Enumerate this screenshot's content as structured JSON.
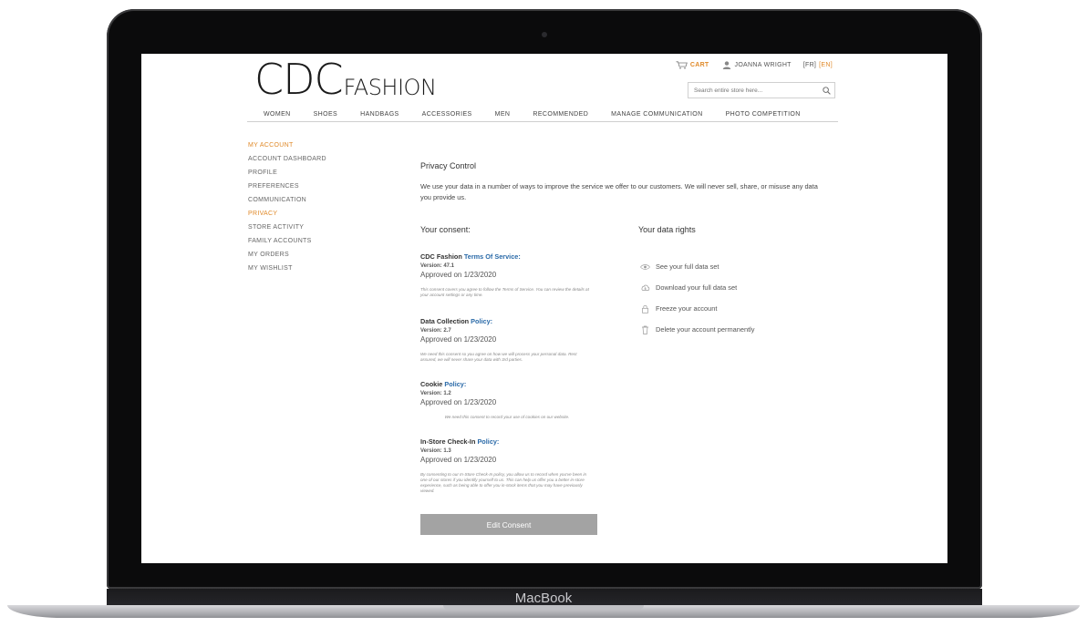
{
  "device": {
    "brand_label": "MacBook"
  },
  "header": {
    "logo": {
      "main": "CDC",
      "sub": "FASHION"
    },
    "cart_label": "CART",
    "user_name": "JOANNA WRIGHT",
    "languages": [
      {
        "label": "[FR]"
      },
      {
        "label": "[EN]",
        "active": true
      }
    ],
    "search_placeholder": "Search entire store here...",
    "accent_color": "#e08a2a"
  },
  "nav": {
    "items": [
      "WOMEN",
      "SHOES",
      "HANDBAGS",
      "ACCESSORIES",
      "MEN",
      "RECOMMENDED",
      "MANAGE COMMUNICATION",
      "PHOTO COMPETITION"
    ]
  },
  "sidebar": {
    "items": [
      {
        "label": "MY ACCOUNT",
        "active": true
      },
      {
        "label": "ACCOUNT DASHBOARD"
      },
      {
        "label": "PROFILE"
      },
      {
        "label": "PREFERENCES"
      },
      {
        "label": "COMMUNICATION"
      },
      {
        "label": "PRIVACY",
        "active": true
      },
      {
        "label": "STORE ACTIVITY"
      },
      {
        "label": "FAMILY ACCOUNTS"
      },
      {
        "label": "MY ORDERS"
      },
      {
        "label": "MY WISHLIST"
      }
    ]
  },
  "main": {
    "title": "Privacy Control",
    "intro": "We use your data in a number of ways to improve the service we offer to our customers. We will never sell, share, or misuse any data you provide us.",
    "consent_heading": "Your consent:",
    "rights_heading": "Your data rights",
    "policies": [
      {
        "title_prefix": "CDC Fashion ",
        "title_link": "Terms Of Service:",
        "version": "Version: 47.1",
        "approved": "Approved on 1/23/2020",
        "description": "This consent covers you agree to follow the Terms of Service. You can review the details at your account settings or any time."
      },
      {
        "title_prefix": "Data Collection ",
        "title_link": "Policy:",
        "version": "Version: 2.7",
        "approved": "Approved on 1/23/2020",
        "description": "We need this consent so you agree on how we will process your personal data. Rest assured, we will never share your data with 3rd parties."
      },
      {
        "title_prefix": "Cookie ",
        "title_link": "Policy:",
        "version": "Version: 1.2",
        "approved": "Approved on 1/23/2020",
        "description": "We need this consent to record your use of cookies on our website."
      },
      {
        "title_prefix": "In-Store Check-In ",
        "title_link": "Policy:",
        "version": "Version: 1.3",
        "approved": "Approved on 1/23/2020",
        "description": "By consenting to our In-Store Check-In policy, you allow us to record when you've been in one of our stores if you identify yourself to us. This can help us offer you a better in-store experience, such as being able to offer you in-stock items that you may have previously viewed."
      }
    ],
    "rights": [
      {
        "label": "See your full data set",
        "icon": "eye-icon"
      },
      {
        "label": "Download your full data set",
        "icon": "download-icon"
      },
      {
        "label": "Freeze your account",
        "icon": "lock-icon"
      },
      {
        "label": "Delete your account permanently",
        "icon": "trash-icon"
      }
    ],
    "edit_button": "Edit Consent"
  }
}
